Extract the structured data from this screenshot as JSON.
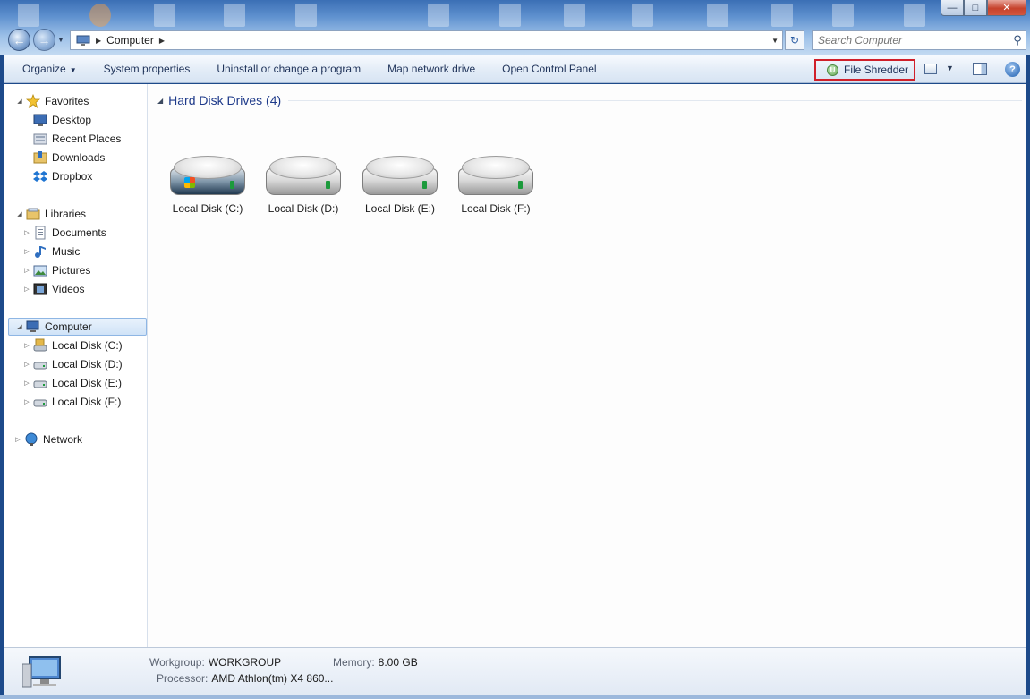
{
  "window": {
    "breadcrumb": "Computer",
    "search_placeholder": "Search Computer"
  },
  "toolbar": {
    "organize": "Organize",
    "system_properties": "System properties",
    "uninstall": "Uninstall or change a program",
    "map_drive": "Map network drive",
    "control_panel": "Open Control Panel",
    "file_shredder": "File Shredder"
  },
  "sidebar": {
    "favorites": "Favorites",
    "desktop": "Desktop",
    "recent_places": "Recent Places",
    "downloads": "Downloads",
    "dropbox": "Dropbox",
    "libraries": "Libraries",
    "documents": "Documents",
    "music": "Music",
    "pictures": "Pictures",
    "videos": "Videos",
    "computer": "Computer",
    "disk_c": "Local Disk (C:)",
    "disk_d": "Local Disk (D:)",
    "disk_e": "Local Disk (E:)",
    "disk_f": "Local Disk (F:)",
    "network": "Network"
  },
  "main": {
    "group_title": "Hard Disk Drives (4)",
    "drives": [
      "Local Disk (C:)",
      "Local Disk (D:)",
      "Local Disk (E:)",
      "Local Disk (F:)"
    ]
  },
  "details": {
    "workgroup_label": "Workgroup:",
    "workgroup_value": "WORKGROUP",
    "memory_label": "Memory:",
    "memory_value": "8.00 GB",
    "processor_label": "Processor:",
    "processor_value": "AMD Athlon(tm) X4 860..."
  },
  "colors": {
    "highlight_box": "#d0202a",
    "group_title": "#1e3a8a"
  }
}
